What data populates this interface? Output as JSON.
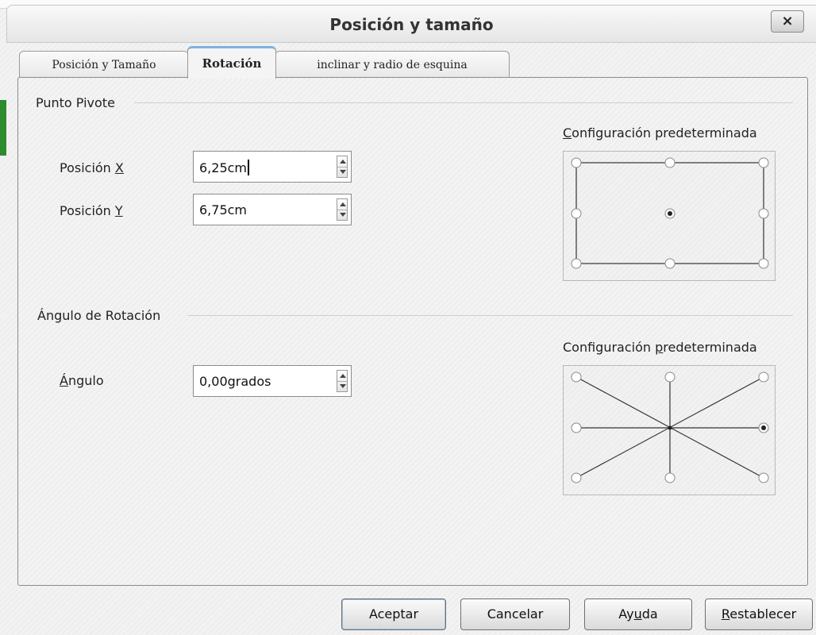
{
  "window": {
    "title": "Posición y tamaño",
    "close_label": "×"
  },
  "tabs": [
    {
      "label": "Posición y Tamaño",
      "active": false
    },
    {
      "label": "Rotación",
      "active": true
    },
    {
      "label": "inclinar y radio de esquina",
      "active": false
    }
  ],
  "pivot": {
    "section_label": "Punto Pivote",
    "x_label_pre": "Posición ",
    "x_label_key": "X",
    "x_value": "6,25cm",
    "y_label_pre": "Posición ",
    "y_label_key": "Y",
    "y_value": "6,75cm",
    "preset_key": "C",
    "preset_rest": "onfiguración predeterminada",
    "selected_position": "center"
  },
  "rotation": {
    "section_label": "Ángulo de Rotación",
    "angle_label_key": "Á",
    "angle_label_rest": "ngulo",
    "angle_value": "0,00grados",
    "preset_pre": "Configuración ",
    "preset_key": "p",
    "preset_rest": "redeterminada",
    "selected_direction": "0 grados (derecha)"
  },
  "buttons": {
    "ok": "Aceptar",
    "cancel": "Cancelar",
    "help_pre": "Ay",
    "help_key": "u",
    "help_post": "da",
    "reset_key": "R",
    "reset_rest": "establecer"
  },
  "colors": {
    "active_tab_accent": "#7fb2dc",
    "background": "#f2f2f2"
  }
}
